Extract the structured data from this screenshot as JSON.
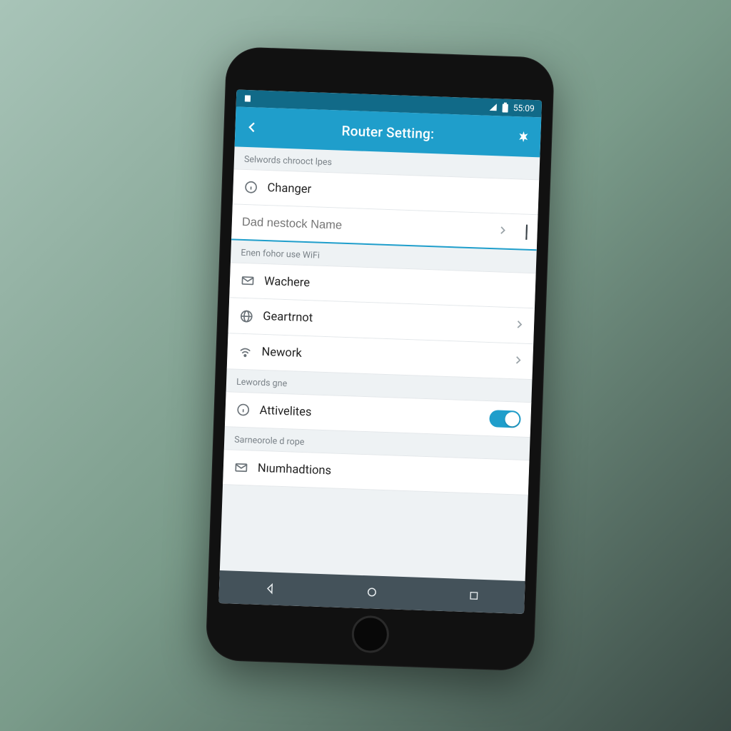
{
  "statusbar": {
    "time": "55:09"
  },
  "header": {
    "title": "Router Setting:"
  },
  "sections": [
    {
      "label": "Selwords chrooct lpes",
      "items": [
        {
          "icon": "info-icon",
          "label": "Changer",
          "chevron": false,
          "type": "nav"
        },
        {
          "type": "input",
          "placeholder": "Dad nestock Name",
          "value": "",
          "active": true,
          "trailing_icon": "save-icon"
        }
      ]
    },
    {
      "label": "Enen fohor use WiFi",
      "items": [
        {
          "icon": "mail-icon",
          "label": "Wachere",
          "type": "nav"
        },
        {
          "icon": "globe-icon",
          "label": "Geartrnot",
          "chevron": true,
          "type": "nav"
        },
        {
          "icon": "wifi-icon",
          "label": "Nework",
          "chevron": true,
          "type": "nav"
        }
      ]
    },
    {
      "label": "Lewords gne",
      "items": [
        {
          "icon": "info-icon",
          "label": "Attivelites",
          "chevron": true,
          "toggle": true,
          "type": "toggle"
        }
      ]
    },
    {
      "label": "Sarneorole d rope",
      "items": [
        {
          "icon": "mail-icon",
          "label": "Nıumhadtions",
          "type": "nav"
        }
      ]
    }
  ],
  "colors": {
    "accent": "#1f9ecb",
    "statusbar": "#116a88",
    "navbar": "#44525a"
  }
}
